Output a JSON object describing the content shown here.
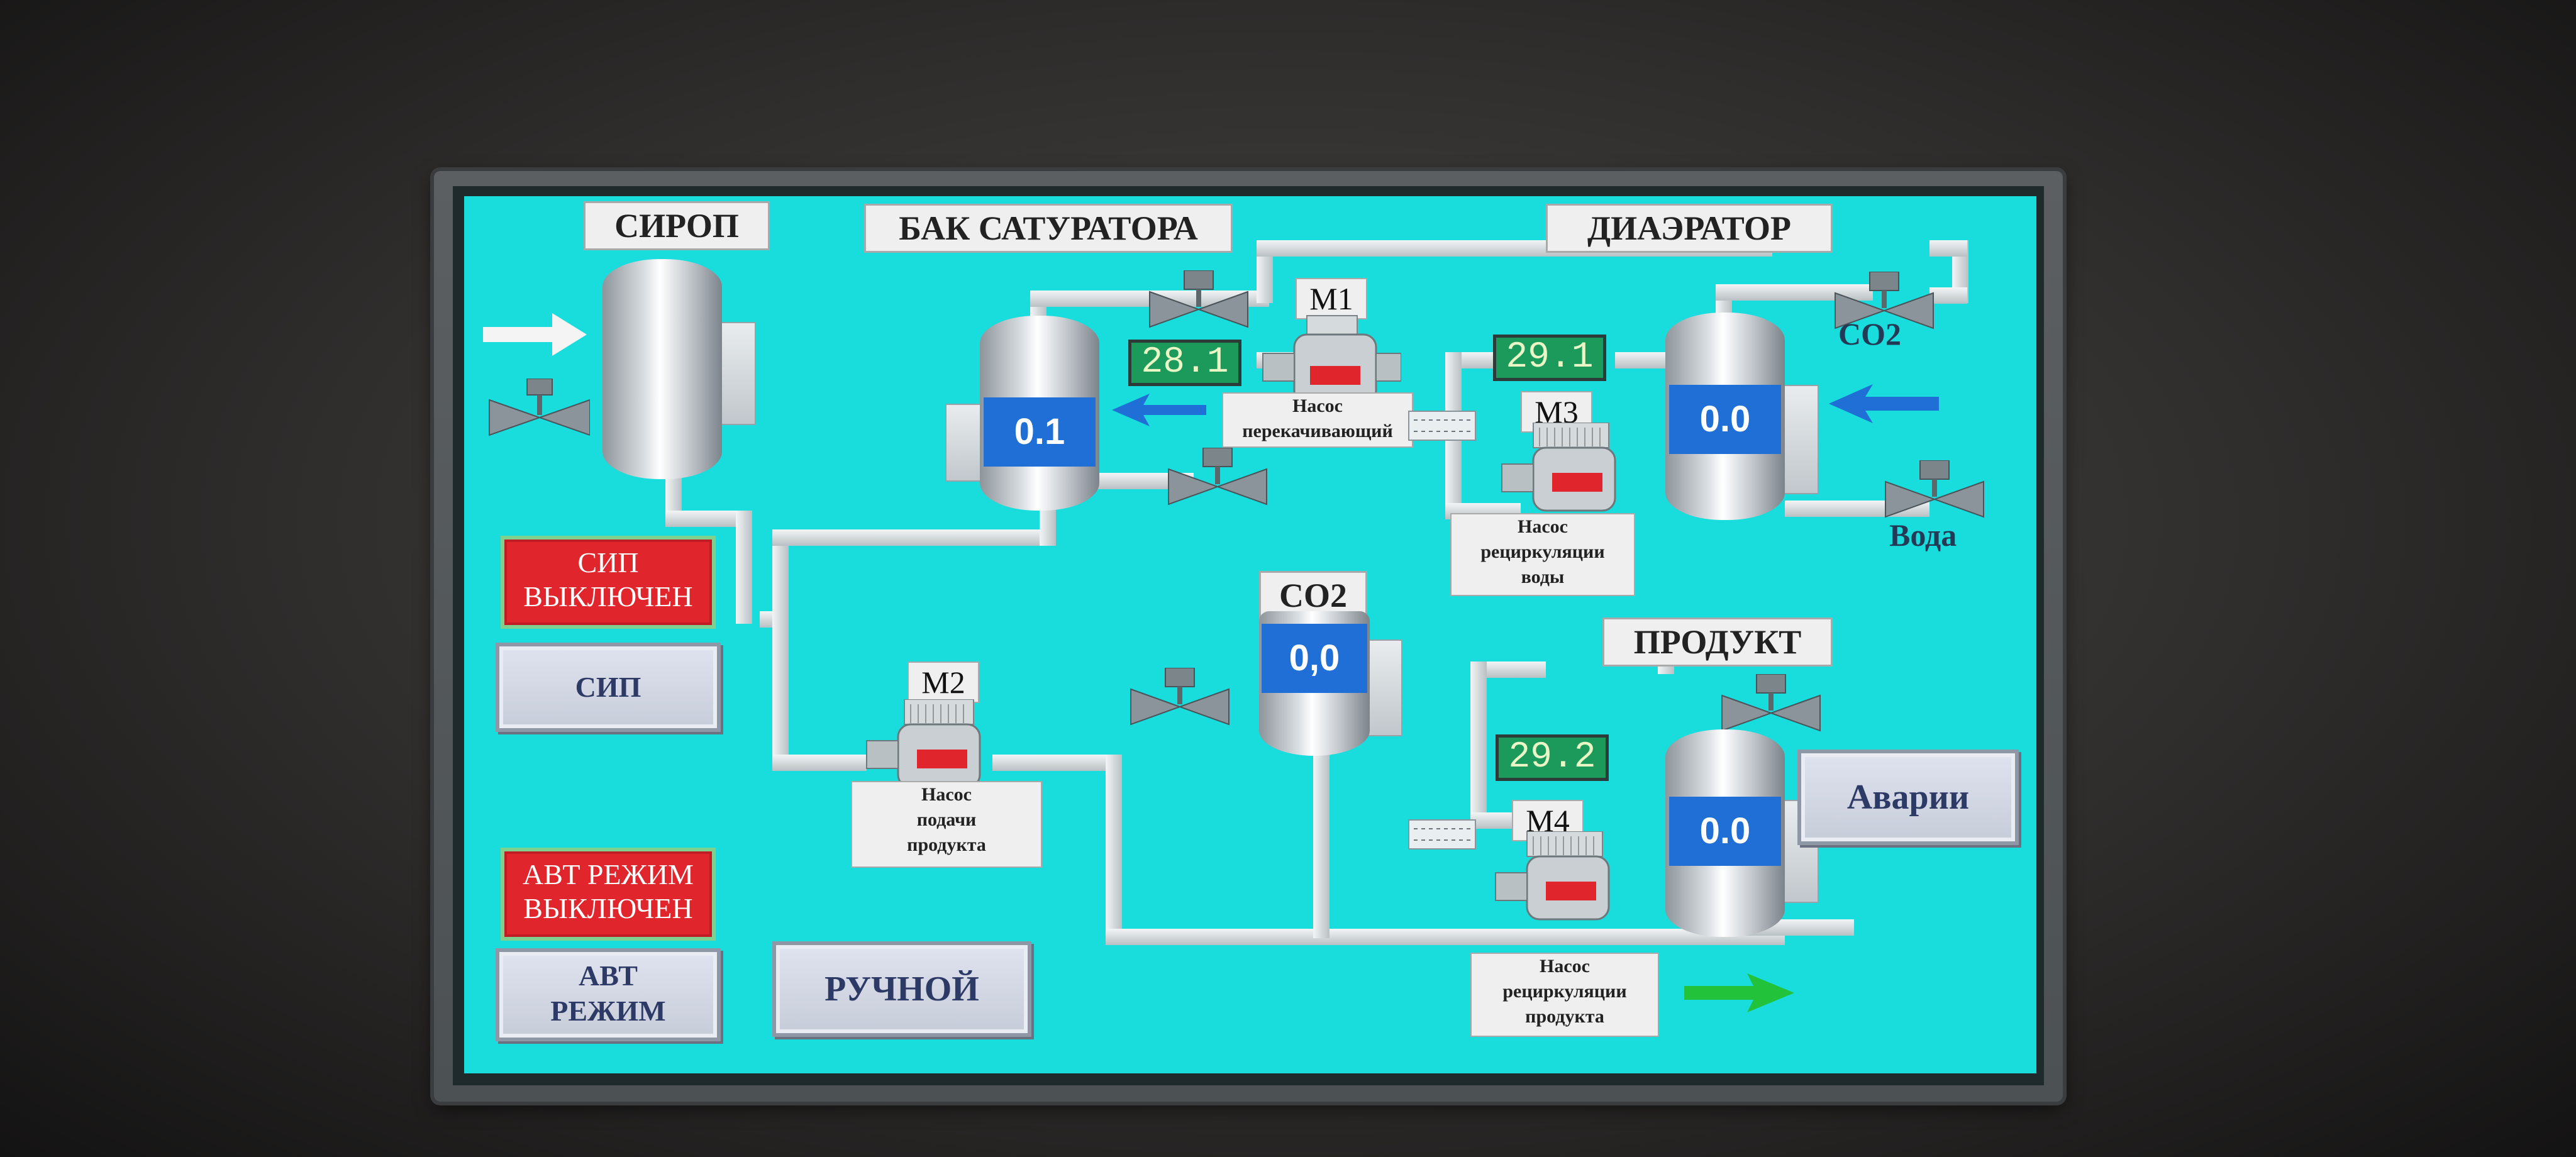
{
  "labels": {
    "syrup": "СИРОП",
    "saturator_tank": "БАК САТУРАТОРА",
    "deaerator": "ДИАЭРАТОР",
    "co2_tank": "CO2",
    "product": "ПРОДУКТ",
    "co2_line": "CO2",
    "water_line": "Вода"
  },
  "tanks": {
    "saturator_level": "0.1",
    "deaerator_level": "0.0",
    "co2_level": "0,0",
    "product_level": "0.0"
  },
  "displays": {
    "d1": "28.1",
    "d2": "29.1",
    "d3": "29.2"
  },
  "motors": {
    "m1": "M1",
    "m2": "M2",
    "m3": "M3",
    "m4": "M4"
  },
  "captions": {
    "m1_line1": "Насос",
    "m1_line2": "перекачивающий",
    "m2_line1": "Насос",
    "m2_line2": "подачи",
    "m2_line3": "продукта",
    "m3_line1": "Насос",
    "m3_line2": "рециркуляции",
    "m3_line3": "воды",
    "m4_line1": "Насос",
    "m4_line2": "рециркуляции",
    "m4_line3": "продукта"
  },
  "status": {
    "cip_line1": "СИП",
    "cip_line2": "ВЫКЛЮЧЕН",
    "auto_line1": "АВТ РЕЖИМ",
    "auto_line2": "ВЫКЛЮЧЕН"
  },
  "buttons": {
    "cip": "СИП",
    "auto_line1": "АВТ",
    "auto_line2": "РЕЖИМ",
    "manual": "РУЧНОЙ",
    "alarms": "Аварии"
  },
  "colors": {
    "screen_bg": "#19dcdc",
    "level_blue": "#1f6fd6",
    "status_red": "#e0252c",
    "display_green": "#1c9a5c",
    "flow_green": "#22c33a",
    "flow_blue": "#1f6fd6"
  },
  "icons": [
    "valve-icon",
    "pump-icon",
    "arrow-right-icon",
    "arrow-left-icon",
    "heat-exchanger-icon"
  ]
}
